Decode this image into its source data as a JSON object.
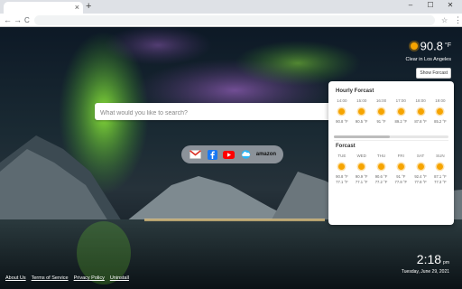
{
  "browser": {
    "tab_close": "×",
    "new_tab": "+",
    "window_controls": [
      "–",
      "☐",
      "✕"
    ],
    "nav": {
      "back": "←",
      "forward": "→",
      "reload": "C",
      "home": "⌂"
    },
    "bookmark_star": "☆",
    "menu": "⋮"
  },
  "weather": {
    "temp": "90.8",
    "unit": "°F",
    "condition": "Clear in Los Angeles",
    "show_button": "Show Forcast",
    "icon": "sun-icon"
  },
  "search": {
    "placeholder": "What would you like to search?"
  },
  "quick_links": [
    {
      "name": "gmail",
      "icon": "gmail-icon",
      "color": "#d93025"
    },
    {
      "name": "facebook",
      "icon": "facebook-icon",
      "color": "#1877f2"
    },
    {
      "name": "youtube",
      "icon": "youtube-icon",
      "color": "#ff0000"
    },
    {
      "name": "weather",
      "icon": "cloud-icon",
      "color": "#29b6f6"
    },
    {
      "name": "amazon",
      "label": "amazon"
    }
  ],
  "forecast": {
    "hourly_title": "Hourly Forcast",
    "hourly": [
      {
        "time": "14:00",
        "temp": "90.8 °F"
      },
      {
        "time": "15:00",
        "temp": "90.5 °F"
      },
      {
        "time": "16:00",
        "temp": "91 °F"
      },
      {
        "time": "17:00",
        "temp": "89.2 °F"
      },
      {
        "time": "18:00",
        "temp": "87.8 °F"
      },
      {
        "time": "19:00",
        "temp": "85.2 °F"
      }
    ],
    "daily_title": "Forcast",
    "daily": [
      {
        "day": "TUE",
        "high": "90.8 °F",
        "low": "77.1 °F"
      },
      {
        "day": "WED",
        "high": "90.9 °F",
        "low": "77.1 °F"
      },
      {
        "day": "THU",
        "high": "90.6 °F",
        "low": "77.2 °F"
      },
      {
        "day": "FRI",
        "high": "91 °F",
        "low": "77.8 °F"
      },
      {
        "day": "SAT",
        "high": "92.4 °F",
        "low": "77.8 °F"
      },
      {
        "day": "SUN",
        "high": "87.1 °F",
        "low": "77.3 °F"
      }
    ]
  },
  "clock": {
    "time": "2:18",
    "ampm": "pm",
    "date": "Tuesday, June 29, 2021"
  },
  "footer": {
    "links": [
      "About Us",
      "Terms of Service",
      "Privacy Policy",
      "Uninstall"
    ]
  },
  "colors": {
    "accent_sun": "#f6a400",
    "card_bg": "#ffffff"
  }
}
